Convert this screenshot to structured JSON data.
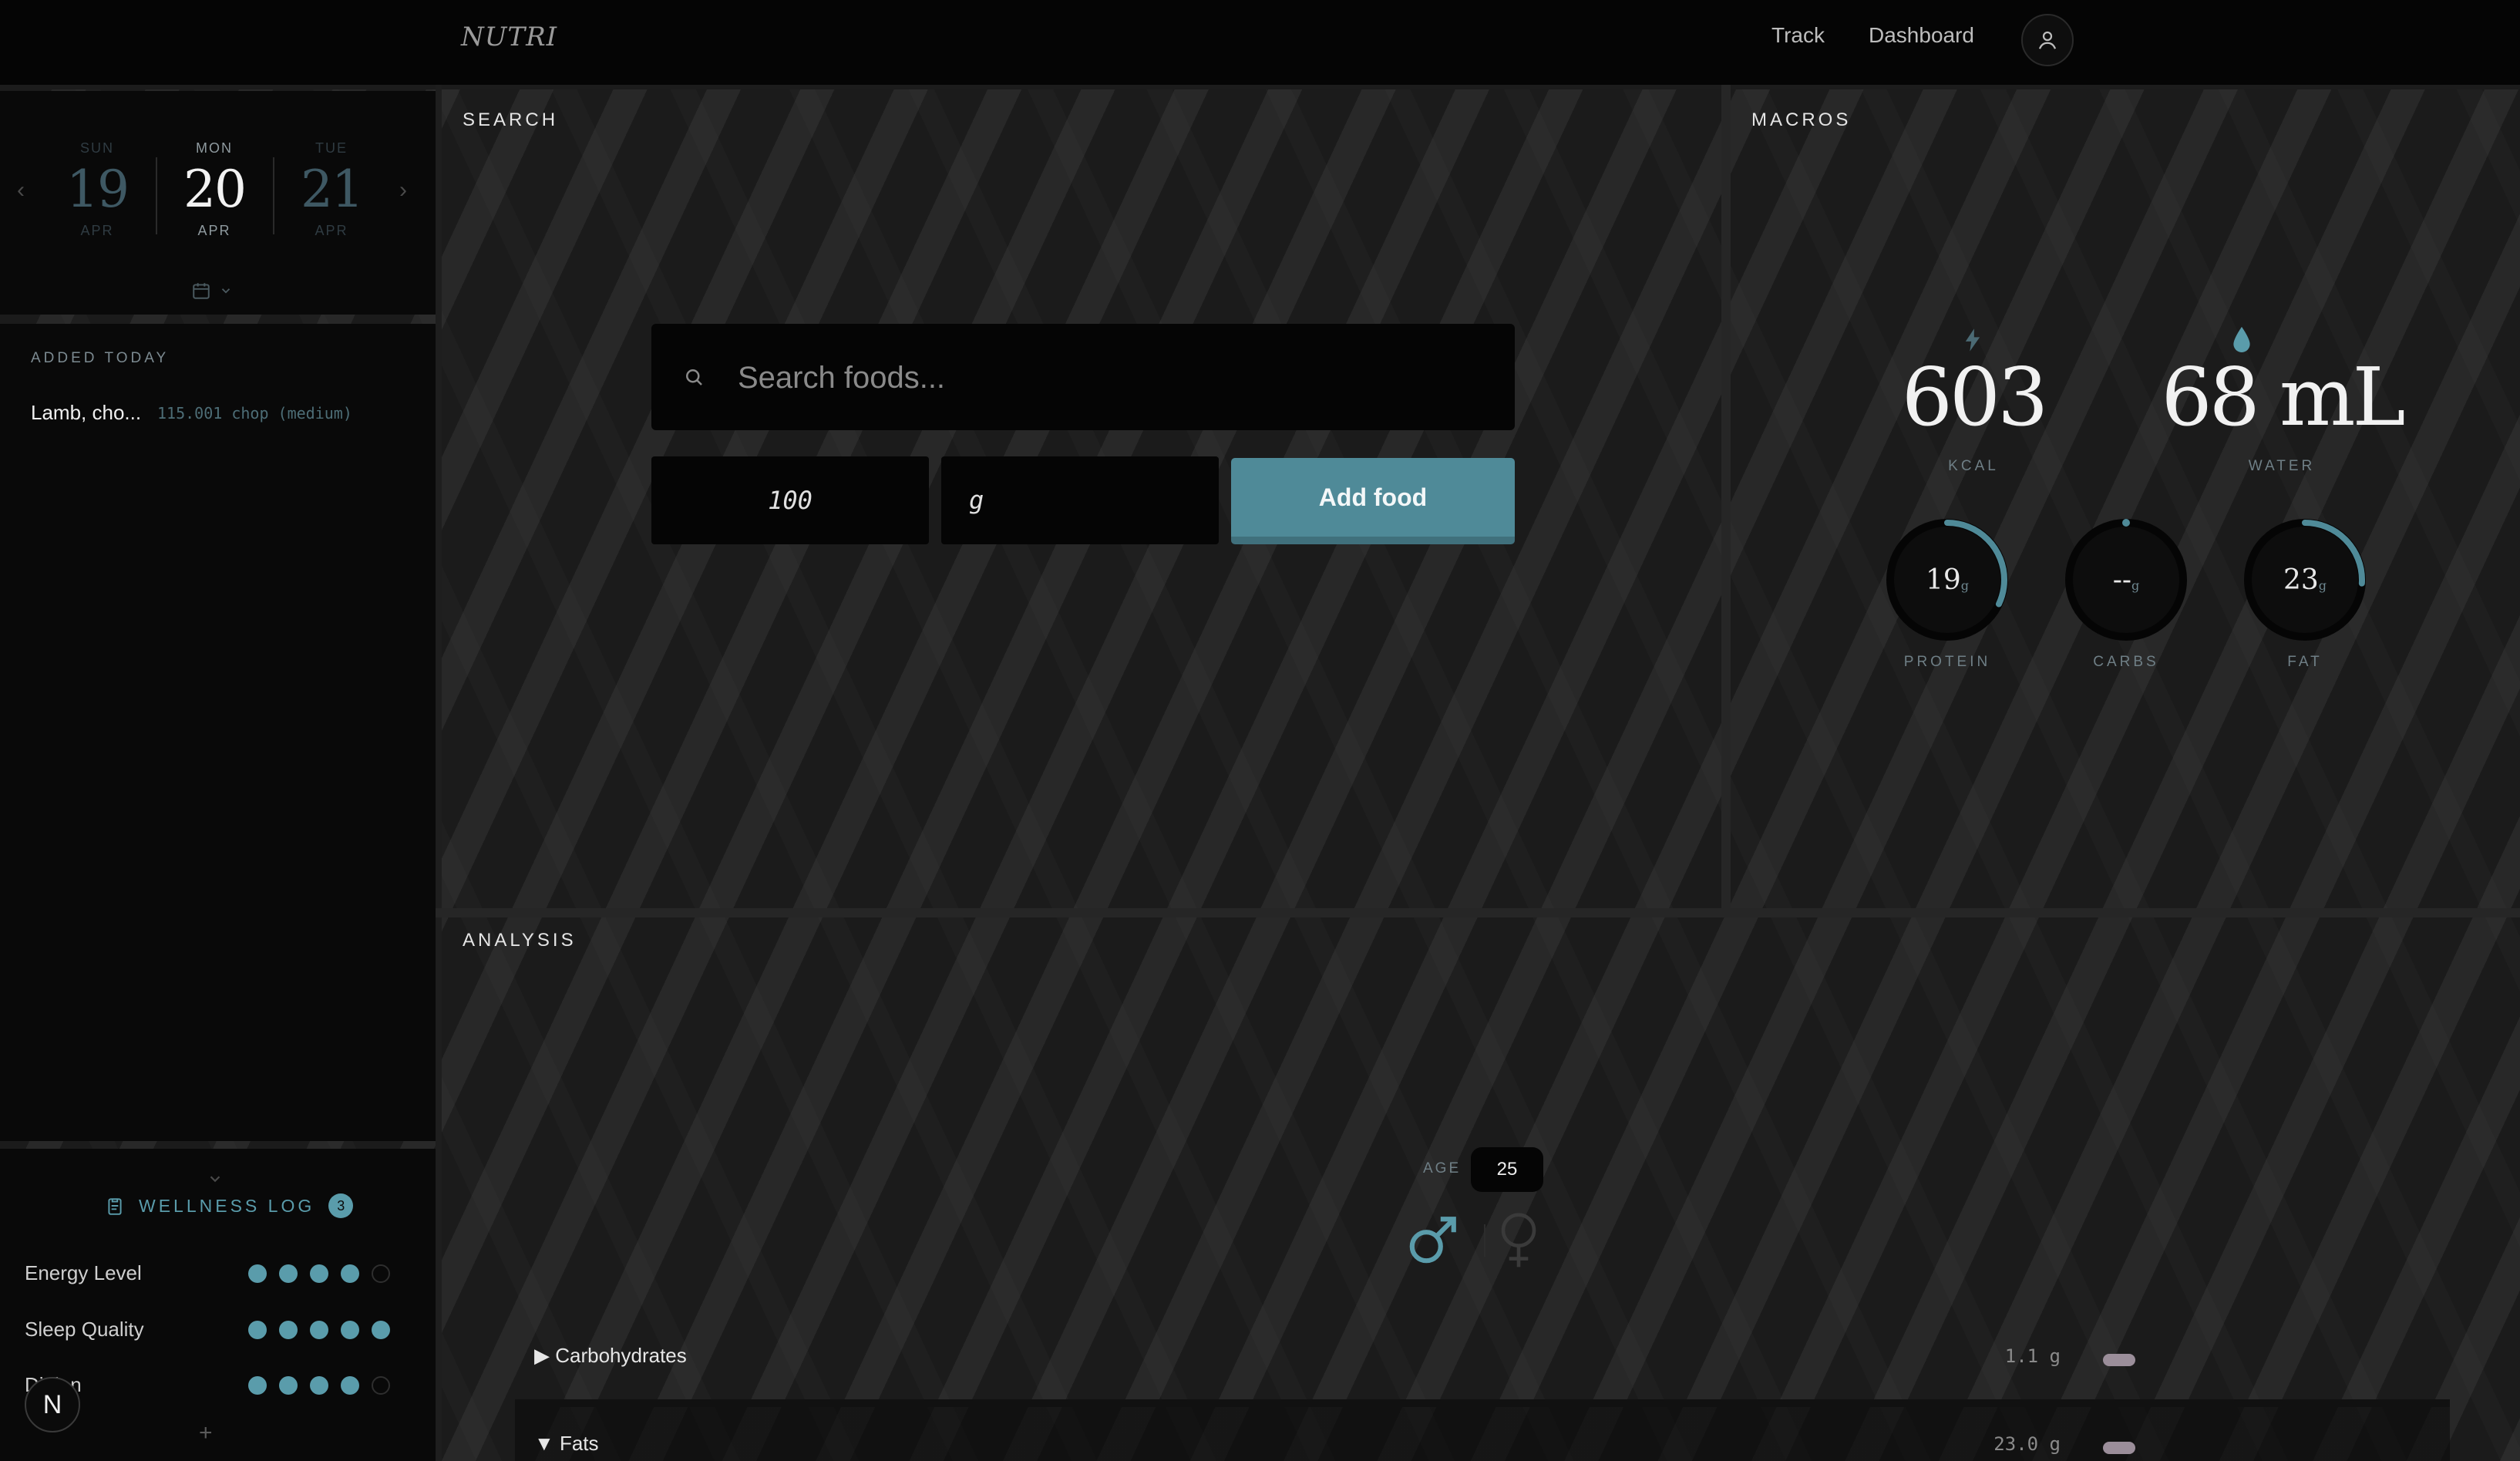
{
  "app": {
    "logo": "NUTRI"
  },
  "nav": {
    "track": "Track",
    "dashboard": "Dashboard"
  },
  "date_picker": {
    "days": [
      {
        "dow": "SUN",
        "num": "19",
        "mon": "APR"
      },
      {
        "dow": "MON",
        "num": "20",
        "mon": "APR"
      },
      {
        "dow": "TUE",
        "num": "21",
        "mon": "APR"
      }
    ]
  },
  "added_today": {
    "title": "ADDED TODAY",
    "items": [
      {
        "name": "Lamb, cho...",
        "amount": "115.001 chop (medium)"
      }
    ]
  },
  "wellness": {
    "title": "WELLNESS LOG",
    "count": "3",
    "rows": [
      {
        "label": "Energy Level",
        "value": 4,
        "max": 5
      },
      {
        "label": "Sleep Quality",
        "value": 5,
        "max": 5
      },
      {
        "label": "Di  tion",
        "value": 4,
        "max": 5
      }
    ],
    "add_label": "+",
    "avatar_letter": "N"
  },
  "search": {
    "title": "SEARCH",
    "placeholder": "Search foods...",
    "quantity": "100",
    "unit": "g",
    "add_button": "Add food"
  },
  "macros": {
    "title": "MACROS",
    "kcal": "603",
    "kcal_label": "KCAL",
    "water": "68 mL",
    "water_label": "WATER",
    "protein": {
      "value": "19",
      "unit": "g",
      "label": "PROTEIN",
      "fraction": 0.32
    },
    "carbs": {
      "value": "--",
      "unit": "g",
      "label": "CARBS",
      "fraction": 0.0
    },
    "fat": {
      "value": "23",
      "unit": "g",
      "label": "FAT",
      "fraction": 0.26
    }
  },
  "analysis": {
    "title": "ANALYSIS",
    "age_label": "AGE",
    "age": "25",
    "rows": [
      {
        "marker": "▶",
        "label": "Carbohydrates",
        "value": "1.1 g"
      },
      {
        "marker": "▼",
        "label": "Fats",
        "value": "23.0 g"
      }
    ]
  },
  "colors": {
    "accent": "#5a9cab",
    "button": "#4f8a98"
  }
}
